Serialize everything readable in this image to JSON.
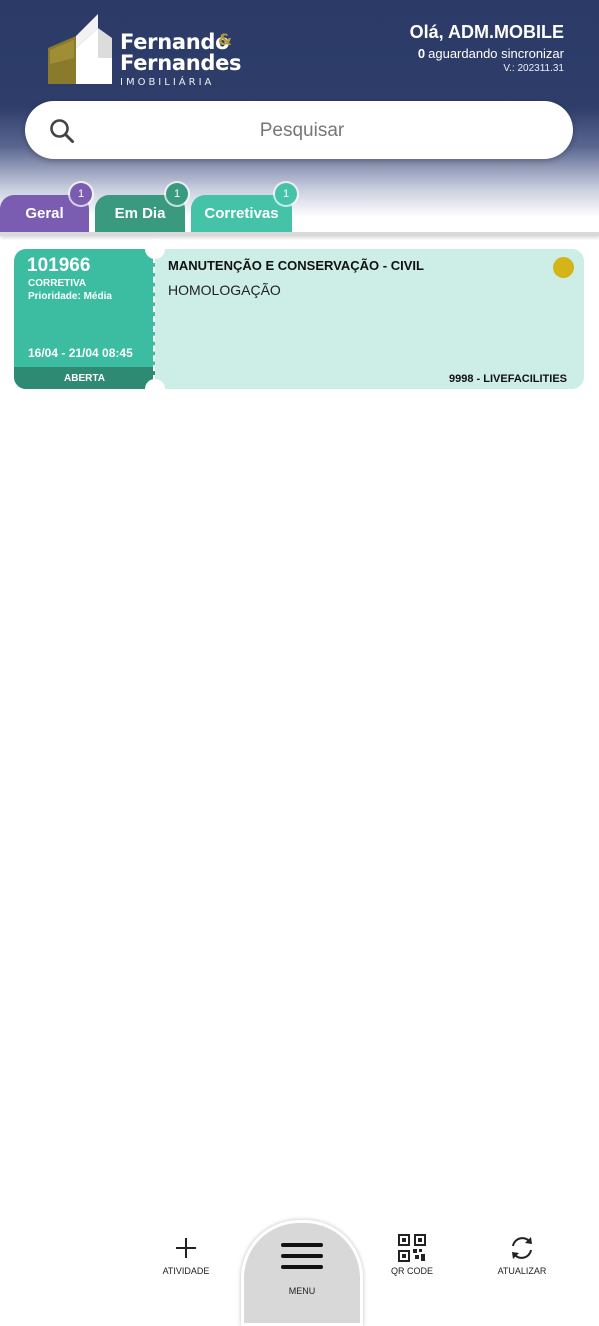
{
  "header": {
    "brand": {
      "line1": "Fernando",
      "ampersand": "&",
      "line2": "Fernandes",
      "line3": "IMOBILIÁRIA"
    },
    "greeting": "Olá, ADM.MOBILE",
    "sync_count": "0",
    "sync_text": "aguardando sincronizar",
    "version": "V.: 202311.31"
  },
  "search": {
    "placeholder": "Pesquisar"
  },
  "tabs": [
    {
      "label": "Geral",
      "badge": "1",
      "color": "#7a5cb0"
    },
    {
      "label": "Em Dia",
      "badge": "1",
      "color": "#3a9a80"
    },
    {
      "label": "Corretivas",
      "badge": "1",
      "color": "#45c3a8"
    }
  ],
  "cards": [
    {
      "id": "101966",
      "type": "CORRETIVA",
      "priority": "Prioridade: Média",
      "date_range": "16/04 - 21/04 08:45",
      "status": "ABERTA",
      "title": "MANUTENÇÃO E CONSERVAÇÃO - CIVIL",
      "subtitle": "HOMOLOGAÇÃO",
      "code": "9998 - LIVEFACILITIES",
      "indicator_color": "#d4b418"
    }
  ],
  "bottom_nav": {
    "add": "ATIVIDADE",
    "menu": "MENU",
    "qr": "QR CODE",
    "refresh": "ATUALIZAR"
  }
}
